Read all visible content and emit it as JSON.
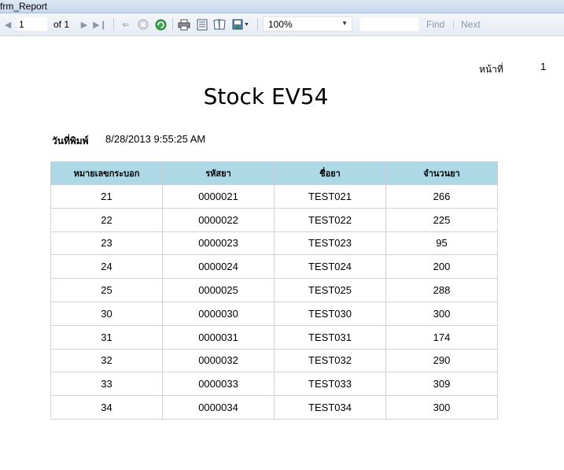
{
  "window": {
    "title": "frm_Report"
  },
  "toolbar": {
    "page_current": "1",
    "page_of": "of 1",
    "zoom_value": "100%",
    "find_label": "Find",
    "next_label": "Next"
  },
  "report": {
    "page_label": "หน้าที่",
    "page_number": "1",
    "title": "Stock EV54",
    "print_date_label": "วันที่พิมพ์",
    "print_date_value": "8/28/2013 9:55:25 AM",
    "table": {
      "header_color": "#add8e6",
      "columns": [
        "หมายเลขกระบอก",
        "รหัสยา",
        "ชื่อยา",
        "จำนวนยา"
      ],
      "rows": [
        [
          "21",
          "0000021",
          "TEST021",
          "266"
        ],
        [
          "22",
          "0000022",
          "TEST022",
          "225"
        ],
        [
          "23",
          "0000023",
          "TEST023",
          "95"
        ],
        [
          "24",
          "0000024",
          "TEST024",
          "200"
        ],
        [
          "25",
          "0000025",
          "TEST025",
          "288"
        ],
        [
          "30",
          "0000030",
          "TEST030",
          "300"
        ],
        [
          "31",
          "0000031",
          "TEST031",
          "174"
        ],
        [
          "32",
          "0000032",
          "TEST032",
          "290"
        ],
        [
          "33",
          "0000033",
          "TEST033",
          "309"
        ],
        [
          "34",
          "0000034",
          "TEST034",
          "300"
        ]
      ]
    }
  }
}
